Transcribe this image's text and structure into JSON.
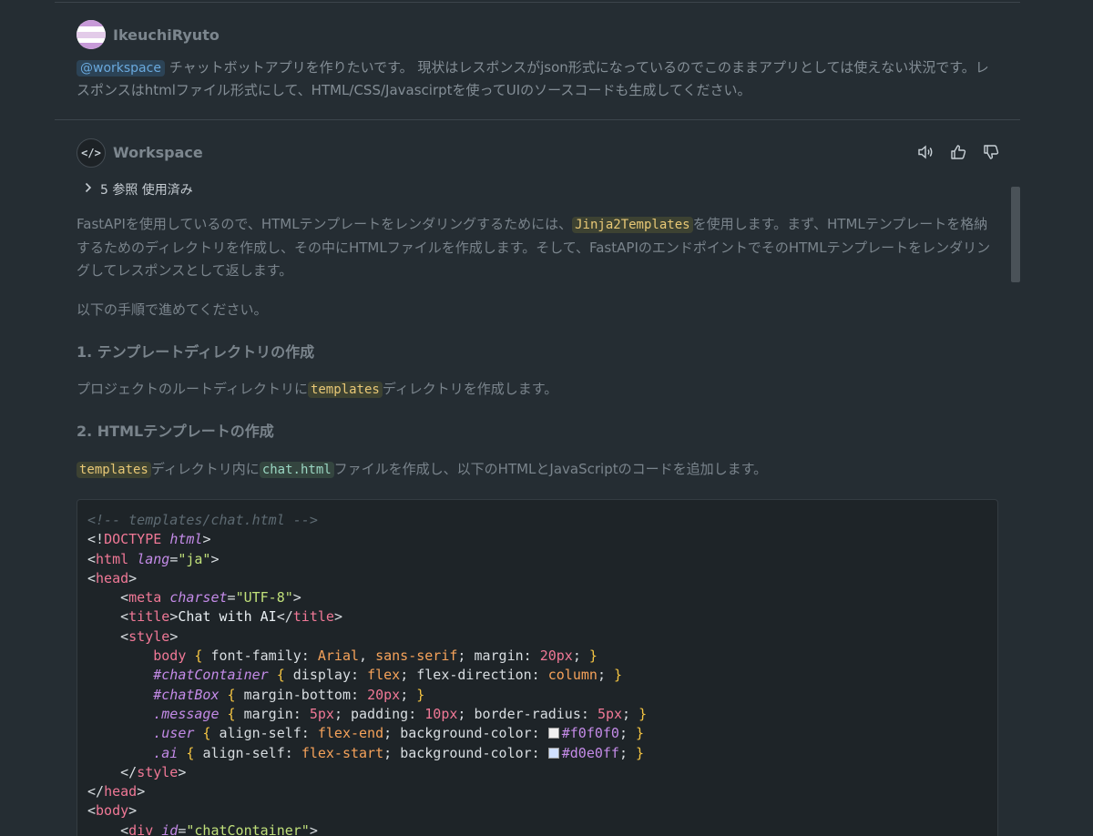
{
  "user_message": {
    "name": "IkeuchiRyuto",
    "mention": "@workspace",
    "text": " チャットボットアプリを作りたいです。 現状はレスポンスがjson形式になっているのでこのままアプリとしては使えない状況です。レスポンスはhtmlファイル形式にして、HTML/CSS/Javascirptを使ってUIのソースコードも生成してください。"
  },
  "assistant": {
    "name": "Workspace",
    "avatar_icon": "code-icon",
    "references_label": "5 参照 使用済み",
    "actions": [
      "speaker-icon",
      "thumbs-up-icon",
      "thumbs-down-icon"
    ],
    "para1": {
      "pre": "FastAPIを使用しているので、HTMLテンプレートをレンダリングするためには、",
      "code": "Jinja2Templates",
      "post": "を使用します。まず、HTMLテンプレートを格納するためのディレクトリを作成し、その中にHTMLファイルを作成します。そして、FastAPIのエンドポイントでそのHTMLテンプレートをレンダリングしてレスポンスとして返します。"
    },
    "para2": "以下の手順で進めてください。",
    "heading1": "1. テンプレートディレクトリの作成",
    "para3": {
      "pre": "プロジェクトのルートディレクトリに",
      "code": "templates",
      "post": "ディレクトリを作成します。"
    },
    "heading2": "2. HTMLテンプレートの作成",
    "para4": {
      "code1": "templates",
      "mid": "ディレクトリ内に",
      "code2": "chat.html",
      "post": "ファイルを作成し、以下のHTMLとJavaScriptのコードを追加します。"
    }
  },
  "code": {
    "comment": "<!-- templates/chat.html -->",
    "doctype_kw": "DOCTYPE",
    "doctype_val": "html",
    "html_tag": "html",
    "lang_attr": "lang",
    "lang_val": "\"ja\"",
    "head_tag": "head",
    "meta_tag": "meta",
    "charset_attr": "charset",
    "charset_val": "\"UTF-8\"",
    "title_tag": "title",
    "title_text": "Chat with AI",
    "style_tag": "style",
    "css": {
      "body_sel": "body",
      "body_decl1_prop": "font-family: ",
      "body_decl1_v1": "Arial",
      "body_decl1_v2": "sans-serif",
      "body_decl2_prop": "margin: ",
      "body_decl2_v": "20px",
      "cc_sel": "#chatContainer",
      "cc_p1": "display: ",
      "cc_v1": "flex",
      "cc_p2": "flex-direction: ",
      "cc_v2": "column",
      "cb_sel": "#chatBox",
      "cb_p1": "margin-bottom: ",
      "cb_v1": "20px",
      "msg_sel": ".message",
      "msg_p1": "margin: ",
      "msg_v1": "5px",
      "msg_p2": "padding: ",
      "msg_v2": "10px",
      "msg_p3": "border-radius: ",
      "msg_v3": "5px",
      "user_sel": ".user",
      "user_p1": "align-self: ",
      "user_v1": "flex-end",
      "user_p2": "background-color: ",
      "user_color": "#f0f0f0",
      "ai_sel": ".ai",
      "ai_p1": "align-self: ",
      "ai_v1": "flex-start",
      "ai_p2": "background-color: ",
      "ai_color": "#d0e0ff"
    },
    "body_tag": "body",
    "div_tag": "div",
    "id_attr": "id",
    "id_val": "\"chatContainer\""
  }
}
